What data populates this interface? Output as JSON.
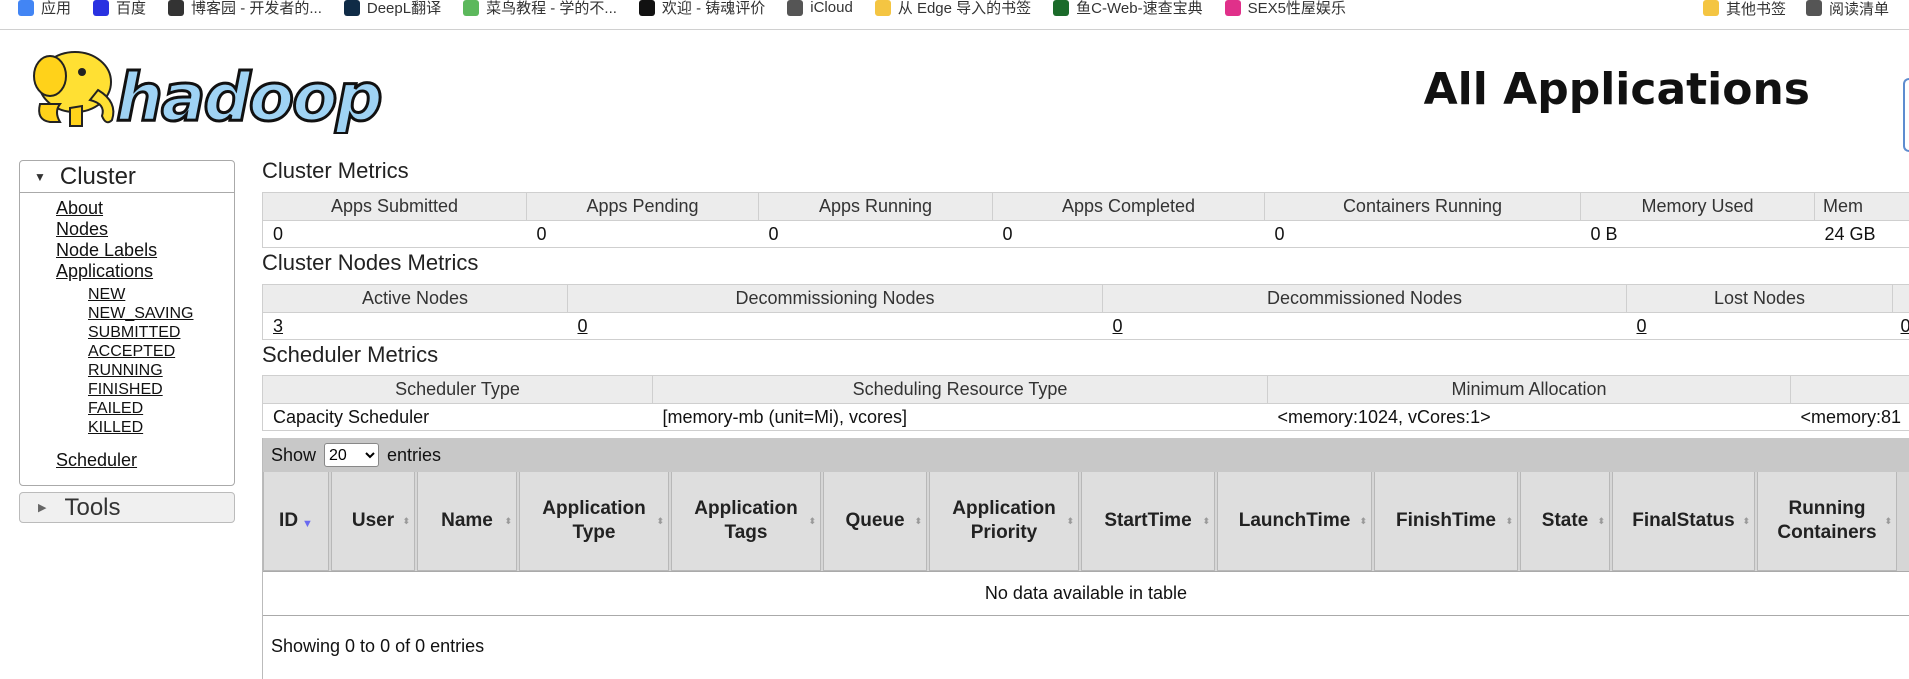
{
  "bookmarks": {
    "left": [
      {
        "label": "应用",
        "icon": "apps-grid-icon",
        "color": "#4285f4"
      },
      {
        "label": "百度",
        "icon": "baidu-paw-icon",
        "color": "#2932e1"
      },
      {
        "label": "博客园 - 开发者的...",
        "icon": "cnblogs-icon",
        "color": "#333333"
      },
      {
        "label": "DeepL翻译",
        "icon": "deepl-icon",
        "color": "#0f2b46"
      },
      {
        "label": "菜鸟教程 - 学的不...",
        "icon": "runoob-icon",
        "color": "#5cb85c"
      },
      {
        "label": "欢迎 - 铸魂评价",
        "icon": "pro-icon",
        "color": "#111111"
      },
      {
        "label": "iCloud",
        "icon": "apple-icon",
        "color": "#555555"
      },
      {
        "label": "从 Edge 导入的书签",
        "icon": "folder-icon",
        "color": "#f4c542"
      },
      {
        "label": "鱼C-Web-速查宝典",
        "icon": "fc-icon",
        "color": "#1b6b2a"
      },
      {
        "label": "SEX5性屋娱乐",
        "icon": "house-icon",
        "color": "#e0308a"
      }
    ],
    "right": [
      {
        "label": "其他书签",
        "icon": "folder-icon",
        "color": "#f4c542"
      },
      {
        "label": "阅读清单",
        "icon": "reading-list-icon",
        "color": "#555555"
      }
    ]
  },
  "header": {
    "logo_text": "hadoop",
    "title": "All Applications"
  },
  "sidebar": {
    "cluster_label": "Cluster",
    "links": [
      "About",
      "Nodes",
      "Node Labels",
      "Applications"
    ],
    "app_states": [
      "NEW",
      "NEW_SAVING",
      "SUBMITTED",
      "ACCEPTED",
      "RUNNING",
      "FINISHED",
      "FAILED",
      "KILLED"
    ],
    "scheduler": "Scheduler",
    "tools_label": "Tools"
  },
  "cluster_metrics": {
    "title": "Cluster Metrics",
    "headers": [
      "Apps Submitted",
      "Apps Pending",
      "Apps Running",
      "Apps Completed",
      "Containers Running",
      "Memory Used",
      "Mem"
    ],
    "values": [
      "0",
      "0",
      "0",
      "0",
      "0",
      "0 B",
      "24 GB"
    ]
  },
  "nodes_metrics": {
    "title": "Cluster Nodes Metrics",
    "headers": [
      "Active Nodes",
      "Decommissioning Nodes",
      "Decommissioned Nodes",
      "Lost Nodes",
      ""
    ],
    "values": [
      "3",
      "0",
      "0",
      "0",
      "0"
    ]
  },
  "scheduler_metrics": {
    "title": "Scheduler Metrics",
    "headers": [
      "Scheduler Type",
      "Scheduling Resource Type",
      "Minimum Allocation",
      ""
    ],
    "values": [
      "Capacity Scheduler",
      "[memory-mb (unit=Mi), vcores]",
      "<memory:1024, vCores:1>",
      "<memory:81"
    ]
  },
  "apps_table": {
    "show_label": "Show",
    "entries_label": "entries",
    "page_size": "20",
    "columns": [
      "ID",
      "User",
      "Name",
      "Application Type",
      "Application Tags",
      "Queue",
      "Application Priority",
      "StartTime",
      "LaunchTime",
      "FinishTime",
      "State",
      "FinalStatus",
      "Running Containers"
    ],
    "empty_message": "No data available in table",
    "info": "Showing 0 to 0 of 0 entries"
  }
}
